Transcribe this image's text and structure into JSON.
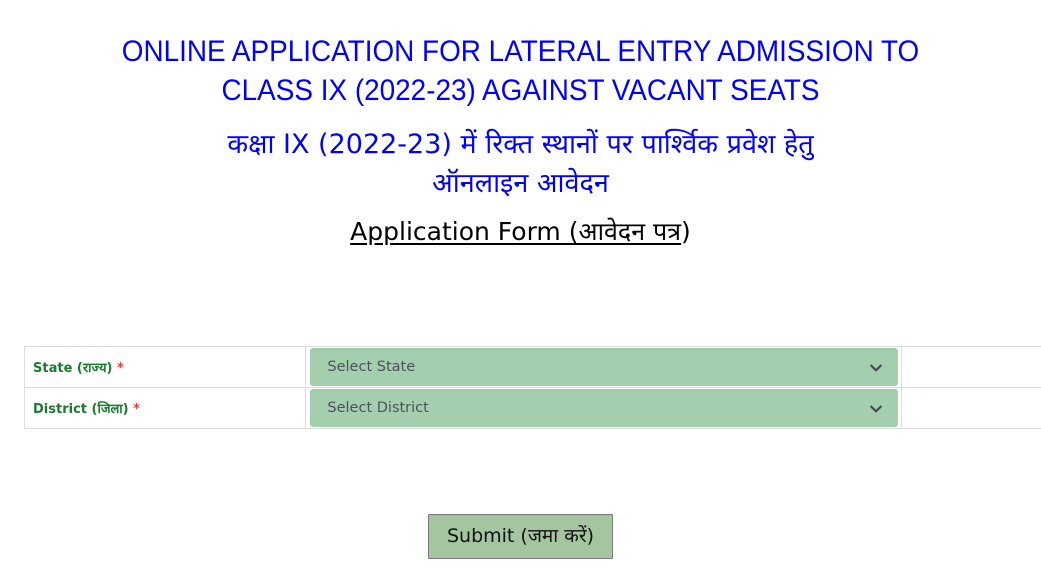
{
  "header": {
    "title_en": "ONLINE APPLICATION FOR LATERAL ENTRY ADMISSION TO\nCLASS IX (2022-23) AGAINST VACANT SEATS",
    "title_hi": "कक्षा IX (2022-23) में रिक्त स्थानों पर पार्श्विक प्रवेश हेतु\nऑनलाइन आवेदन",
    "form_title_en": "Application Form (",
    "form_title_hi": "आवेदन पत्र",
    "form_title_close": ")",
    "title_color": "#0000ff",
    "form_title_color": "#000000"
  },
  "form": {
    "rows": [
      {
        "label_en": "State",
        "label_hi": "(राज्य)",
        "required_mark": "*",
        "field_name": "state",
        "selected_value": "Select State",
        "icon": "chevron-down-icon"
      },
      {
        "label_en": "District",
        "label_hi": "(जिला)",
        "required_mark": "*",
        "field_name": "district",
        "selected_value": "Select District",
        "icon": "chevron-down-icon"
      }
    ],
    "label_color": "#1a7a2e",
    "required_color": "#ff3333",
    "select_background": "#a3cfae",
    "select_text_color": "#4a5259"
  },
  "actions": {
    "submit_label": "Submit (जमा करें)",
    "submit_background": "#a4c5a0",
    "submit_border": "#7a7a7a"
  }
}
